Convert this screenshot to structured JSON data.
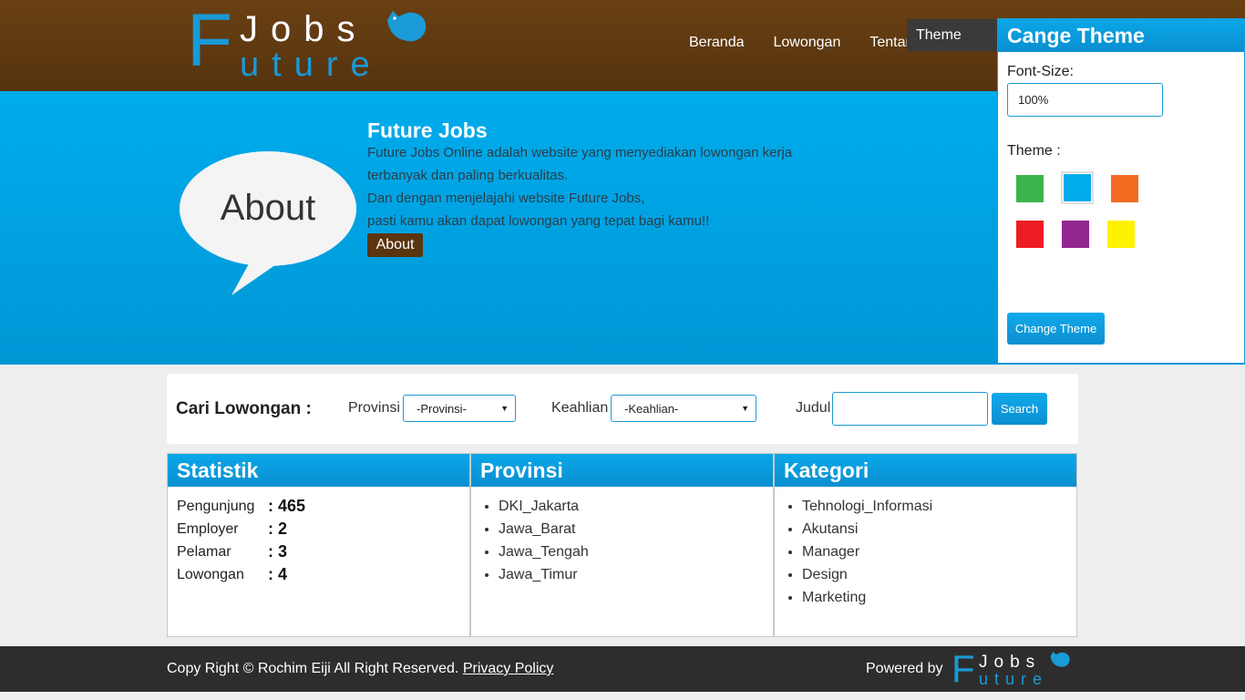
{
  "logo": {
    "letter_f": "F",
    "word_jobs": "Jobs",
    "word_uture": "uture"
  },
  "nav": {
    "items": [
      "Beranda",
      "Lowongan",
      "Tentang"
    ]
  },
  "theme_tab": {
    "label": "Theme"
  },
  "hero": {
    "bubble_text": "About",
    "title": "Future Jobs",
    "lines": [
      "Future Jobs Online adalah website yang menyediakan lowongan kerja",
      "terbanyak dan paling berkualitas.",
      "Dan dengan menjelajahi website Future Jobs,",
      "pasti kamu akan dapat lowongan yang tepat bagi kamu!!"
    ],
    "button": "About"
  },
  "theme_panel": {
    "title": "Cange Theme",
    "font_size_label": "Font-Size:",
    "font_size_value": "100%",
    "theme_label": "Theme :",
    "swatches": [
      "#3cb44b",
      "#00acec",
      "#f26b21",
      "#ed1c24",
      "#92278f",
      "#fff200"
    ],
    "selected_swatch": "#00acec",
    "button": "Change Theme"
  },
  "search": {
    "title": "Cari Lowongan :",
    "provinsi_label": "Provinsi",
    "provinsi_value": "-Provinsi-",
    "keahlian_label": "Keahlian",
    "keahlian_value": "-Keahlian-",
    "judul_label": "Judul",
    "judul_value": "",
    "button": "Search"
  },
  "statistik": {
    "title": "Statistik",
    "rows": [
      {
        "label": "Pengunjung",
        "value": ": 465"
      },
      {
        "label": "Employer",
        "value": ": 2"
      },
      {
        "label": "Pelamar",
        "value": ": 3"
      },
      {
        "label": "Lowongan",
        "value": ": 4"
      }
    ]
  },
  "provinsi": {
    "title": "Provinsi",
    "items": [
      "DKI_Jakarta",
      "Jawa_Barat",
      "Jawa_Tengah",
      "Jawa_Timur"
    ]
  },
  "kategori": {
    "title": "Kategori",
    "items": [
      "Tehnologi_Informasi",
      "Akutansi",
      "Manager",
      "Design",
      "Marketing"
    ]
  },
  "footer": {
    "copyright": "Copy Right © Rochim Eiji All Right Reserved.",
    "privacy": "Privacy Policy",
    "powered_by": "Powered by"
  },
  "colors": {
    "brand_brown": "#5a3510",
    "accent_blue": "#00acec",
    "logo_blue": "#1a9ad6",
    "footer_dark": "#2d2d2d"
  }
}
